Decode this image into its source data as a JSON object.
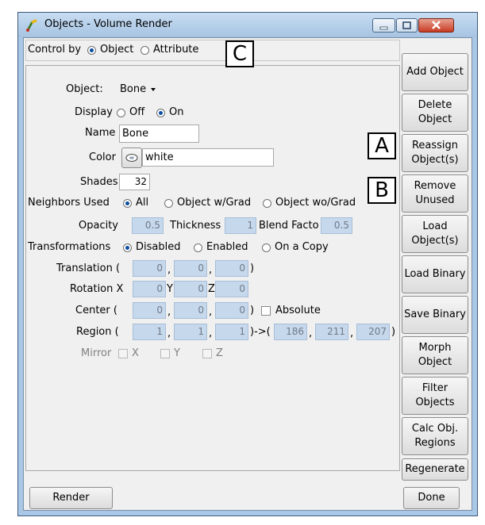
{
  "window": {
    "title": "Objects - Volume Render"
  },
  "control_by": {
    "label": "Control by",
    "options": [
      "Object",
      "Attribute"
    ],
    "selected": "Object"
  },
  "object": {
    "label": "Object:",
    "value": "Bone"
  },
  "display": {
    "label": "Display",
    "options": [
      "Off",
      "On"
    ],
    "selected": "On"
  },
  "name": {
    "label": "Name",
    "value": "Bone"
  },
  "color": {
    "label": "Color",
    "value": "white"
  },
  "shades": {
    "label": "Shades",
    "value": "32"
  },
  "neighbors": {
    "label": "Neighbors Used",
    "options": [
      "All",
      "Object w/Grad",
      "Object wo/Grad"
    ],
    "selected": "All"
  },
  "opacity": {
    "label": "Opacity",
    "value": "0.5"
  },
  "thickness": {
    "label": "Thickness",
    "value": "1"
  },
  "blend": {
    "label": "Blend Facto",
    "value": "0.5"
  },
  "transformations": {
    "label": "Transformations",
    "options": [
      "Disabled",
      "Enabled",
      "On a Copy"
    ],
    "selected": "Disabled"
  },
  "translation": {
    "label": "Translation (",
    "values": [
      "0",
      "0",
      "0"
    ],
    "close": ")",
    "sep": ","
  },
  "rotation": {
    "label": "Rotation X",
    "y": "Y",
    "z": "Z",
    "values": [
      "0",
      "0",
      "0"
    ]
  },
  "center": {
    "label": "Center (",
    "values": [
      "0",
      "0",
      "0"
    ],
    "close": ")",
    "sep": ",",
    "absolute": "Absolute"
  },
  "region": {
    "label": "Region (",
    "from": [
      "1",
      "1",
      "1"
    ],
    "arrow": ")->(",
    "to": [
      "186",
      "211",
      "207"
    ],
    "close": ")",
    "sep": ","
  },
  "mirror": {
    "label": "Mirror",
    "axes": [
      "X",
      "Y",
      "Z"
    ]
  },
  "side_buttons": [
    "Add Object",
    "Delete Object",
    "Reassign Object(s)",
    "Remove Unused",
    "Load Object(s)",
    "Load Binary",
    "Save Binary",
    "Morph Object",
    "Filter Objects",
    "Calc Obj. Regions",
    "Regenerate"
  ],
  "bottom": {
    "render": "Render",
    "done": "Done"
  },
  "annotations": {
    "a": "A",
    "b": "B",
    "c": "C"
  }
}
